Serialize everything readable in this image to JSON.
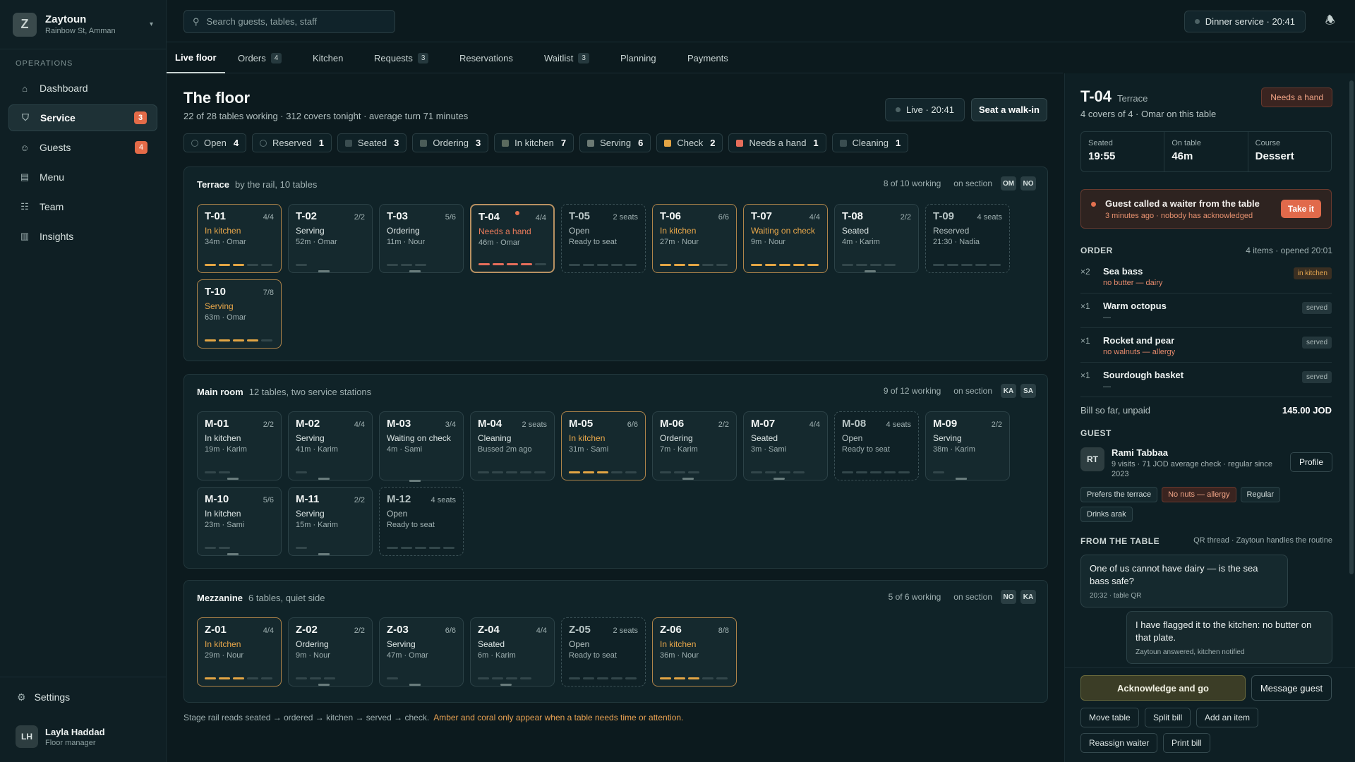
{
  "brand": {
    "initial": "Z",
    "name": "Zaytoun",
    "sub": "Rainbow St, Amman"
  },
  "sidebar": {
    "section": "OPERATIONS",
    "items": [
      {
        "label": "Dashboard",
        "icon": "dashboard-icon",
        "badge": ""
      },
      {
        "label": "Service",
        "icon": "service-icon",
        "badge": "3"
      },
      {
        "label": "Guests",
        "icon": "guests-icon",
        "badge": "4"
      },
      {
        "label": "Menu",
        "icon": "menu-book-icon",
        "badge": ""
      },
      {
        "label": "Team",
        "icon": "team-icon",
        "badge": ""
      },
      {
        "label": "Insights",
        "icon": "chart-icon",
        "badge": ""
      }
    ],
    "settings": "Settings",
    "user": {
      "initials": "LH",
      "name": "Layla Haddad",
      "role": "Floor manager"
    }
  },
  "topbar": {
    "search_placeholder": "Search guests, tables, staff",
    "service": "Dinner service · ",
    "time": "20:41"
  },
  "tabs": [
    {
      "label": "Live floor",
      "badge": ""
    },
    {
      "label": "Orders",
      "badge": "4"
    },
    {
      "label": "Kitchen",
      "badge": ""
    },
    {
      "label": "Requests",
      "badge": "3"
    },
    {
      "label": "Reservations",
      "badge": ""
    },
    {
      "label": "Waitlist",
      "badge": "3"
    },
    {
      "label": "Planning",
      "badge": ""
    },
    {
      "label": "Payments",
      "badge": ""
    }
  ],
  "floor": {
    "title": "The floor",
    "subtitle": "22 of 28 tables working · 312 covers tonight · average turn 71 minutes",
    "live": "Live · ",
    "live_time": "20:41",
    "walkin": "Seat a walk-in"
  },
  "filters": [
    {
      "label": "Open",
      "count": "4",
      "color": "#0f2126",
      "border": "#5a6f72"
    },
    {
      "label": "Reserved",
      "count": "1",
      "color": "#0f2126",
      "border": "#5a6f72"
    },
    {
      "label": "Seated",
      "count": "3",
      "color": "#3a4d50",
      "border": "#3a4d50"
    },
    {
      "label": "Ordering",
      "count": "3",
      "color": "#4b5c58",
      "border": "#4b5c58"
    },
    {
      "label": "In kitchen",
      "count": "7",
      "color": "#5b6a5e",
      "border": "#5b6a5e"
    },
    {
      "label": "Serving",
      "count": "6",
      "color": "#6c7a74",
      "border": "#6c7a74"
    },
    {
      "label": "Check",
      "count": "2",
      "color": "#e3a544",
      "border": "#e3a544"
    },
    {
      "label": "Needs a hand",
      "count": "1",
      "color": "#e56d5a",
      "border": "#e56d5a"
    },
    {
      "label": "Cleaning",
      "count": "1",
      "color": "#3a4d50",
      "border": "#3a4d50"
    }
  ],
  "sections": [
    {
      "name": "Terrace",
      "desc": "by the rail, 10 tables",
      "working": "8 of 10 working",
      "on": "on section",
      "staff": [
        "OM",
        "NO"
      ],
      "tables": [
        {
          "code": "T-01",
          "cap": "4/4",
          "status": "In kitchen",
          "tone": "amber",
          "meta": "34m · Omar",
          "stage": 3,
          "railtone": "amber",
          "kind": "warn"
        },
        {
          "code": "T-02",
          "cap": "2/2",
          "status": "Serving",
          "tone": "",
          "meta": "52m · Omar",
          "stage": 4,
          "railtone": "on",
          "kind": ""
        },
        {
          "code": "T-03",
          "cap": "5/6",
          "status": "Ordering",
          "tone": "",
          "meta": "11m · Nour",
          "stage": 2,
          "railtone": "on",
          "kind": ""
        },
        {
          "code": "T-04",
          "cap": "4/4",
          "status": "Needs a hand",
          "tone": "coral",
          "meta": "46m · Omar",
          "stage": 4,
          "railtone": "coral",
          "kind": "alert"
        },
        {
          "code": "T-05",
          "cap": "2 seats",
          "status": "Open",
          "tone": "",
          "meta": "Ready to seat",
          "stage": 0,
          "railtone": "on",
          "kind": "open"
        },
        {
          "code": "T-06",
          "cap": "6/6",
          "status": "In kitchen",
          "tone": "amber",
          "meta": "27m · Nour",
          "stage": 3,
          "railtone": "amber",
          "kind": "warn"
        },
        {
          "code": "T-07",
          "cap": "4/4",
          "status": "Waiting on check",
          "tone": "amber",
          "meta": "9m · Nour",
          "stage": 5,
          "railtone": "amber",
          "kind": "warn"
        },
        {
          "code": "T-08",
          "cap": "2/2",
          "status": "Seated",
          "tone": "",
          "meta": "4m · Karim",
          "stage": 1,
          "railtone": "on",
          "kind": ""
        },
        {
          "code": "T-09",
          "cap": "4 seats",
          "status": "Reserved",
          "tone": "",
          "meta": "21:30 · Nadia",
          "stage": 0,
          "railtone": "on",
          "kind": "open"
        },
        {
          "code": "T-10",
          "cap": "7/8",
          "status": "Serving",
          "tone": "amber",
          "meta": "63m · Omar",
          "stage": 4,
          "railtone": "amber",
          "kind": "warn"
        }
      ]
    },
    {
      "name": "Main room",
      "desc": "12 tables, two service stations",
      "working": "9 of 12 working",
      "on": "on section",
      "staff": [
        "KA",
        "SA"
      ],
      "tables": [
        {
          "code": "M-01",
          "cap": "2/2",
          "status": "In kitchen",
          "tone": "",
          "meta": "19m · Karim",
          "stage": 3,
          "railtone": "on",
          "kind": ""
        },
        {
          "code": "M-02",
          "cap": "4/4",
          "status": "Serving",
          "tone": "",
          "meta": "41m · Karim",
          "stage": 4,
          "railtone": "on",
          "kind": ""
        },
        {
          "code": "M-03",
          "cap": "3/4",
          "status": "Waiting on check",
          "tone": "",
          "meta": "4m · Sami",
          "stage": 5,
          "railtone": "on",
          "kind": ""
        },
        {
          "code": "M-04",
          "cap": "2 seats",
          "status": "Cleaning",
          "tone": "",
          "meta": "Bussed 2m ago",
          "stage": 0,
          "railtone": "on",
          "kind": ""
        },
        {
          "code": "M-05",
          "cap": "6/6",
          "status": "In kitchen",
          "tone": "amber",
          "meta": "31m · Sami",
          "stage": 3,
          "railtone": "amber",
          "kind": "warn"
        },
        {
          "code": "M-06",
          "cap": "2/2",
          "status": "Ordering",
          "tone": "",
          "meta": "7m · Karim",
          "stage": 2,
          "railtone": "on",
          "kind": ""
        },
        {
          "code": "M-07",
          "cap": "4/4",
          "status": "Seated",
          "tone": "",
          "meta": "3m · Sami",
          "stage": 1,
          "railtone": "on",
          "kind": ""
        },
        {
          "code": "M-08",
          "cap": "4 seats",
          "status": "Open",
          "tone": "",
          "meta": "Ready to seat",
          "stage": 0,
          "railtone": "on",
          "kind": "open"
        },
        {
          "code": "M-09",
          "cap": "2/2",
          "status": "Serving",
          "tone": "",
          "meta": "38m · Karim",
          "stage": 4,
          "railtone": "on",
          "kind": ""
        },
        {
          "code": "M-10",
          "cap": "5/6",
          "status": "In kitchen",
          "tone": "",
          "meta": "23m · Sami",
          "stage": 3,
          "railtone": "on",
          "kind": ""
        },
        {
          "code": "M-11",
          "cap": "2/2",
          "status": "Serving",
          "tone": "",
          "meta": "15m · Karim",
          "stage": 4,
          "railtone": "on",
          "kind": ""
        },
        {
          "code": "M-12",
          "cap": "4 seats",
          "status": "Open",
          "tone": "",
          "meta": "Ready to seat",
          "stage": 0,
          "railtone": "on",
          "kind": "open"
        }
      ]
    },
    {
      "name": "Mezzanine",
      "desc": "6 tables, quiet side",
      "working": "5 of 6 working",
      "on": "on section",
      "staff": [
        "NO",
        "KA"
      ],
      "tables": [
        {
          "code": "Z-01",
          "cap": "4/4",
          "status": "In kitchen",
          "tone": "amber",
          "meta": "29m · Nour",
          "stage": 3,
          "railtone": "amber",
          "kind": "warn"
        },
        {
          "code": "Z-02",
          "cap": "2/2",
          "status": "Ordering",
          "tone": "",
          "meta": "9m · Nour",
          "stage": 2,
          "railtone": "on",
          "kind": ""
        },
        {
          "code": "Z-03",
          "cap": "6/6",
          "status": "Serving",
          "tone": "",
          "meta": "47m · Omar",
          "stage": 4,
          "railtone": "on",
          "kind": ""
        },
        {
          "code": "Z-04",
          "cap": "4/4",
          "status": "Seated",
          "tone": "",
          "meta": "6m · Karim",
          "stage": 1,
          "railtone": "on",
          "kind": ""
        },
        {
          "code": "Z-05",
          "cap": "2 seats",
          "status": "Open",
          "tone": "",
          "meta": "Ready to seat",
          "stage": 0,
          "railtone": "on",
          "kind": "open"
        },
        {
          "code": "Z-06",
          "cap": "8/8",
          "status": "In kitchen",
          "tone": "amber",
          "meta": "36m · Nour",
          "stage": 3,
          "railtone": "amber",
          "kind": "warn"
        }
      ]
    }
  ],
  "footnote": {
    "text": "Stage rail reads seated → ordered → kitchen → served → check.",
    "accent": "Amber and coral only appear when a table needs time or attention."
  },
  "panel": {
    "code": "T-04",
    "area": "Terrace",
    "sub": "4 covers of 4 · Omar on this table",
    "badge": "Needs a hand",
    "stats": [
      {
        "label": "Seated",
        "value": "19:55"
      },
      {
        "label": "On table",
        "value": "46m"
      },
      {
        "label": "Course",
        "value": "Dessert"
      }
    ],
    "call": {
      "title": "Guest called a waiter from the table",
      "sub": "3 minutes ago · nobody has acknowledged",
      "action": "Take it"
    },
    "order_label": "ORDER",
    "order_meta": "4 items · opened 20:01",
    "order": [
      {
        "qty": "×2",
        "name": "Sea bass",
        "note": "no butter — dairy",
        "badge": "in kitchen",
        "notecls": "",
        "bcls": "kit"
      },
      {
        "qty": "×1",
        "name": "Warm octopus",
        "note": "—",
        "badge": "served",
        "notecls": "muted",
        "bcls": ""
      },
      {
        "qty": "×1",
        "name": "Rocket and pear",
        "note": "no walnuts — allergy",
        "badge": "served",
        "notecls": "",
        "bcls": ""
      },
      {
        "qty": "×1",
        "name": "Sourdough basket",
        "note": "—",
        "badge": "served",
        "notecls": "muted",
        "bcls": ""
      }
    ],
    "bill_label": "Bill so far, unpaid",
    "bill": "145.00 JOD",
    "guest_label": "GUEST",
    "guest": {
      "initials": "RT",
      "name": "Rami Tabbaa",
      "meta": "9 visits · 71 JOD average check · regular since 2023",
      "profile": "Profile"
    },
    "tags": [
      {
        "t": "Prefers the terrace",
        "cls": ""
      },
      {
        "t": "No nuts — allergy",
        "cls": "allergy"
      },
      {
        "t": "Regular",
        "cls": ""
      },
      {
        "t": "Drinks arak",
        "cls": ""
      }
    ],
    "from_label": "FROM THE TABLE",
    "from_meta": "QR thread · Zaytoun handles the routine",
    "msg_in": {
      "text": "One of us cannot have dairy — is the sea bass safe?",
      "sub": "20:32 · table QR"
    },
    "msg_out": {
      "text": "I have flagged it to the kitchen: no butter on that plate.",
      "sub": "Zaytoun answered, kitchen notified"
    },
    "ack": "Acknowledge and go",
    "message": "Message guest",
    "buttons": [
      "Move table",
      "Split bill",
      "Add an item",
      "Reassign waiter",
      "Print bill"
    ]
  }
}
